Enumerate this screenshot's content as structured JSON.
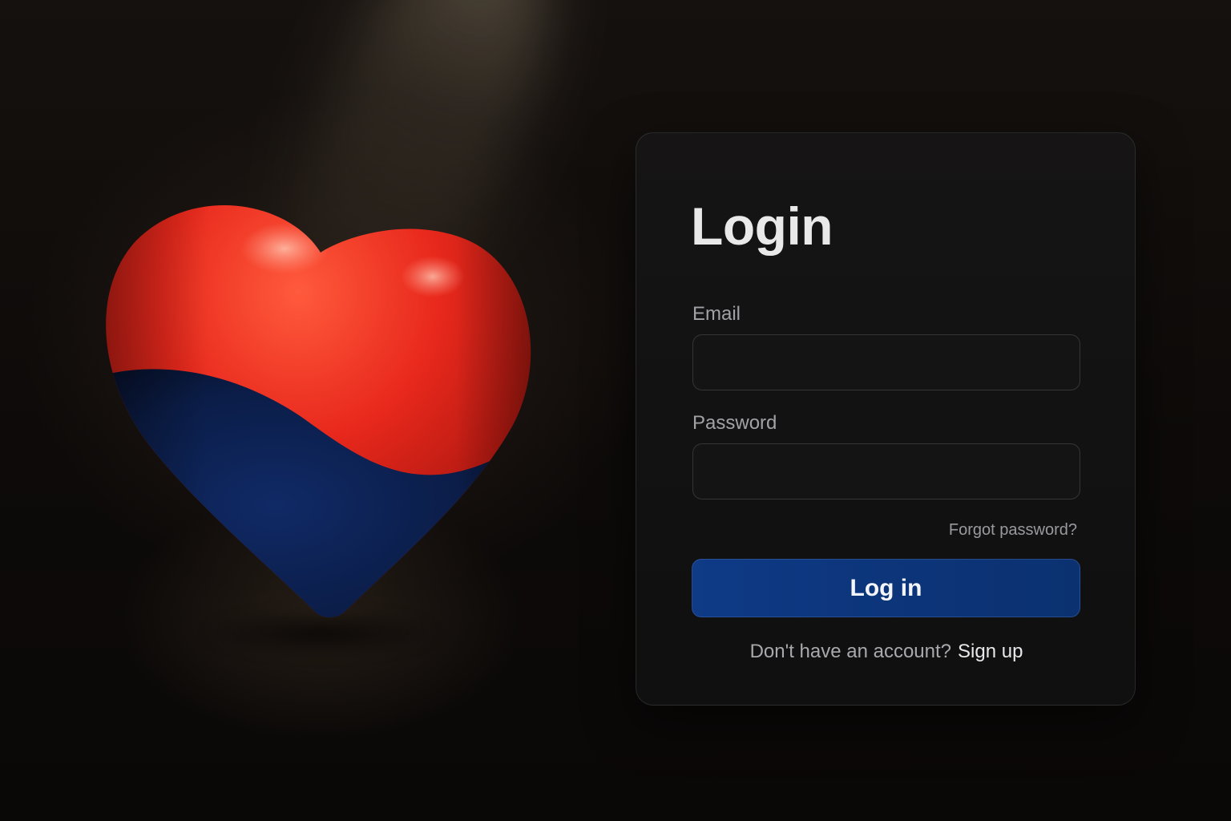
{
  "login": {
    "title": "Login",
    "email_label": "Email",
    "email_value": "",
    "password_label": "Password",
    "password_value": "",
    "forgot_link": "Forgot password?",
    "submit_label": "Log in",
    "signup_prompt": "Don't have an account?",
    "signup_link": "Sign up"
  },
  "colors": {
    "background": "#0b0908",
    "card": "#161616",
    "button": "#0d3780",
    "heart_top": "#e8281c",
    "heart_bottom": "#0c1f4d"
  },
  "illustration": {
    "icon": "heart-icon"
  }
}
